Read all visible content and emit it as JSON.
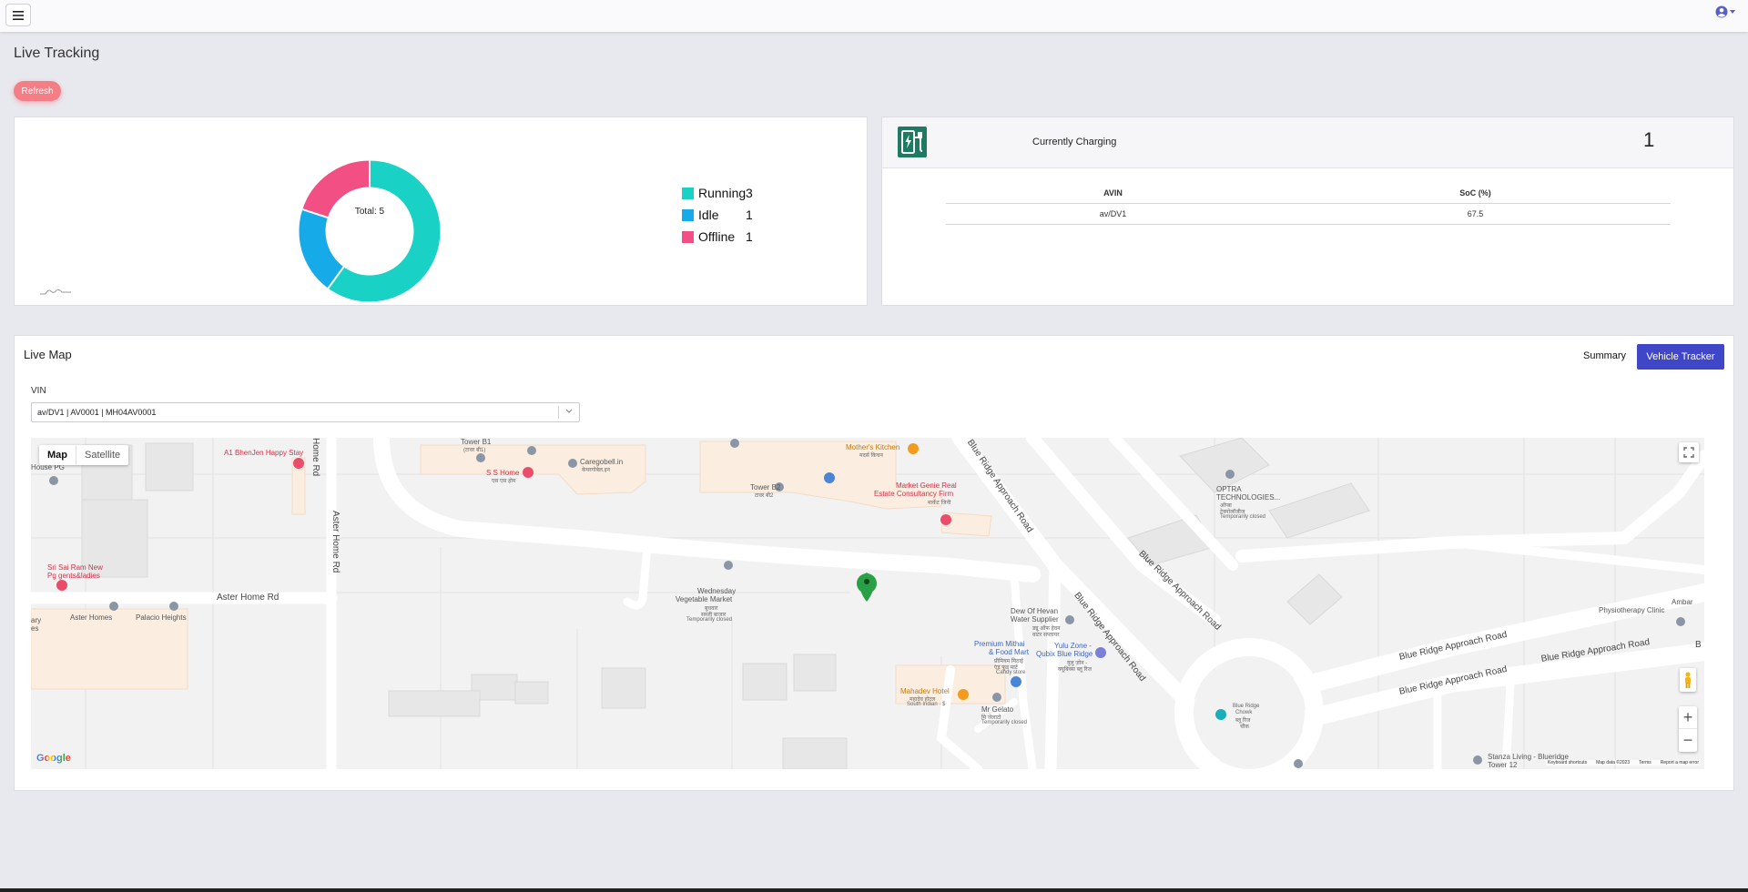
{
  "header": {
    "menu_icon": "hamburger-icon",
    "user_icon": "user-circle-icon"
  },
  "page": {
    "title": "Live Tracking",
    "refresh_label": "Refresh"
  },
  "status_card": {
    "total_label": "Total: 5",
    "chart_data": {
      "type": "pie",
      "title": "",
      "categories": [
        "Running",
        "Idle",
        "Offline"
      ],
      "values": [
        3,
        1,
        1
      ],
      "colors": [
        "#1ad1c5",
        "#17aae8",
        "#f24f85"
      ],
      "total": 5,
      "legend_position": "right"
    },
    "legend": [
      {
        "label": "Running",
        "count": "3",
        "color": "#1ad1c5"
      },
      {
        "label": "Idle",
        "count": "1",
        "color": "#17aae8"
      },
      {
        "label": "Offline",
        "count": "1",
        "color": "#f24f85"
      }
    ]
  },
  "charging_card": {
    "icon": "ev-charger-icon",
    "label": "Currently Charging",
    "count": "1",
    "columns": [
      "AVIN",
      "SoC (%)"
    ],
    "rows": [
      {
        "avin": "av/DV1",
        "soc": "67.5"
      }
    ]
  },
  "live_map": {
    "title": "Live Map",
    "summary_label": "Summary",
    "tracker_label": "Vehicle Tracker",
    "vin_label": "VIN",
    "vin_value": "av/DV1 | AV0001 | MH04AV0001",
    "map_type_map": "Map",
    "map_type_satellite": "Satellite",
    "google_label": "Google",
    "attribution": [
      "Keyboard shortcuts",
      "Map data ©2023",
      "Terms",
      "Report a map error"
    ],
    "labels": {
      "a1": "A1 BhenJen Happy Stay",
      "house_pg": "House PG",
      "home_rd_v": "Home Rd",
      "aster_home_rd_v": "Aster Home Rd",
      "aster_home_rd": "Aster Home Rd",
      "sri_sai_1": "Sri Sai Ram New",
      "sri_sai_2": "Pg gents&ladies",
      "aster_homes": "Aster Homes",
      "palacio": "Palacio Heights",
      "tower_b1": "Tower B1",
      "tower_b1_local": "(टावर बी1)",
      "ss_home": "S S Home",
      "ss_home_local": "एस एस होम",
      "caregobell": "Caregobell.in",
      "caregobell_local": "केयरगोबेल.इन",
      "mothers_kitchen": "Mother's Kitchen",
      "mothers_kitchen_local": "मदर्स किचन",
      "tower_b2": "Tower B2",
      "tower_b2_local": "टावर बी2",
      "market_genie_1": "Market Genie Real",
      "market_genie_2": "Estate Consultancy Firm",
      "market_genie_local": "मार्केट जिनी",
      "blue_ridge_1": "Blue Ridge Approach Road",
      "blue_ridge_2": "Blue Ridge Approach Road",
      "blue_ridge_3": "Blue Ridge Approach Road",
      "blue_ridge_4": "Blue Ridge Approach Road",
      "blue_ridge_5": "Blue Ridge Approach Road",
      "blue_ridge_6": "Blue Ridge Approach Road",
      "optra_1": "OPTRA",
      "optra_2": "TECHNOLOGIES...",
      "optra_local_1": "ऑप्त्रा",
      "optra_local_2": "टेक्नोलॉजीज",
      "temp_closed_1": "Temporarily closed",
      "wed_market_1": "Wednesday",
      "wed_market_2": "Vegetable Market",
      "wed_market_local_1": "बुधवार",
      "wed_market_local_2": "सब्जी बाजार",
      "temp_closed_2": "Temporarily closed",
      "dew_1": "Dew Of Hevan",
      "dew_2": "Water Supplier",
      "dew_local_1": "ड्यू ऑफ हेवन",
      "dew_local_2": "वाटर सप्लायर",
      "premium_1": "Premium Mithai",
      "premium_2": "& Food Mart",
      "premium_local_1": "प्रीमियम मिठाई",
      "premium_local_2": "एंड फूड मार्ट",
      "premium_sub": "Candy store",
      "yulu_1": "Yulu Zone -",
      "yulu_2": "Qubix Blue Ridge",
      "yulu_local_1": "युलु ज़ोन -",
      "yulu_local_2": "क्यूबिक्स ब्लू रिज",
      "mahadev_1": "Mahadev Hotel",
      "mahadev_local": "महादेव होटल",
      "mahadev_sub": "South Indian · $",
      "mr_gelato": "Mr Gelato",
      "mr_gelato_local": "मि जेलाटो",
      "temp_closed_3": "Temporarily closed",
      "br_chowk_1": "Blue Ridge",
      "br_chowk_2": "Chowk",
      "br_chowk_local_1": "ब्लू रिज",
      "br_chowk_local_2": "चौक",
      "ambar_1": "Ambar",
      "ambar_2": "Physiotherapy Clinic",
      "stanza_1": "Stanza Living - Blueridge",
      "stanza_2": "Tower 12",
      "ary_1": "ary",
      "ary_2": "es",
      "edge_b": "B"
    }
  }
}
